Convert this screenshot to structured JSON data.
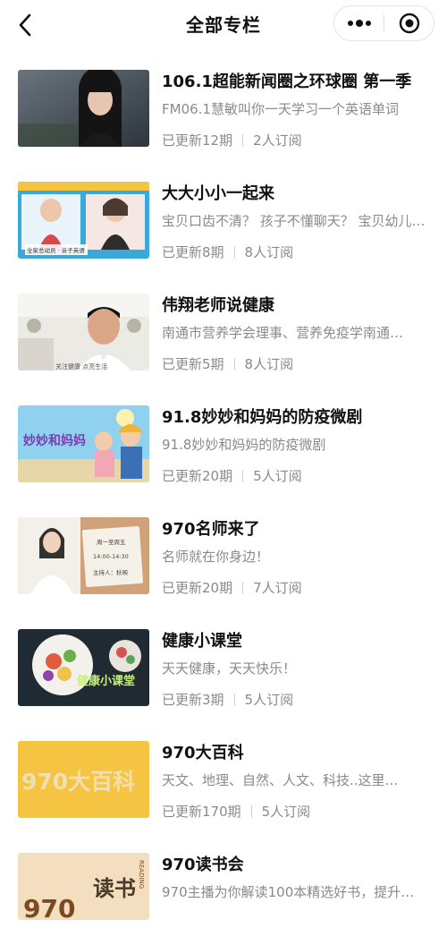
{
  "header": {
    "title": "全部专栏",
    "back_icon": "back-arrow-icon",
    "more_icon": "more-dots-icon",
    "close_icon": "record-circle-icon"
  },
  "colors": {
    "text_primary": "#111111",
    "text_secondary": "#8a8a8a"
  },
  "columns": [
    {
      "title": "106.1超能新闻圈之环球圈 第一季",
      "desc": "FM06.1慧敏叫你一天学习一个英语单词",
      "updates": "已更新12期",
      "subs": "2人订阅"
    },
    {
      "title": "大大小小一起来",
      "desc": "宝贝口齿不清？ 孩子不懂聊天？ 宝贝幼儿…",
      "updates": "已更新8期",
      "subs": "8人订阅"
    },
    {
      "title": "伟翔老师说健康",
      "desc": "南通市营养学会理事、营养免疫学南通…",
      "updates": "已更新5期",
      "subs": "8人订阅"
    },
    {
      "title": "91.8妙妙和妈妈的防疫微剧",
      "desc": "91.8妙妙和妈妈的防疫微剧",
      "updates": "已更新20期",
      "subs": "5人订阅"
    },
    {
      "title": "970名师来了",
      "desc": "名师就在你身边！",
      "updates": "已更新20期",
      "subs": "7人订阅"
    },
    {
      "title": "健康小课堂",
      "desc": "天天健康，天天快乐！",
      "updates": "已更新3期",
      "subs": "5人订阅"
    },
    {
      "title": "970大百科",
      "desc": "天文、地理、自然、人文、科技..这里…",
      "updates": "已更新170期",
      "subs": "5人订阅"
    },
    {
      "title": "970读书会",
      "desc": "970主播为你解读100本精选好书，提升…",
      "updates": "",
      "subs": ""
    }
  ],
  "thumbs": {
    "t2_caption": "全家总动员 · 亲子英语",
    "t3_caption": "关注健康 点亮生活",
    "t4_text": "妙妙和妈妈",
    "t5_lines": [
      "周一至周五",
      "14:00-14:30",
      "主持人：秋映"
    ],
    "t6_text": "健康小课堂",
    "t7_text": "970大百科",
    "t8_text_a": "970",
    "t8_text_b": "读书",
    "t8_side": "READING"
  }
}
